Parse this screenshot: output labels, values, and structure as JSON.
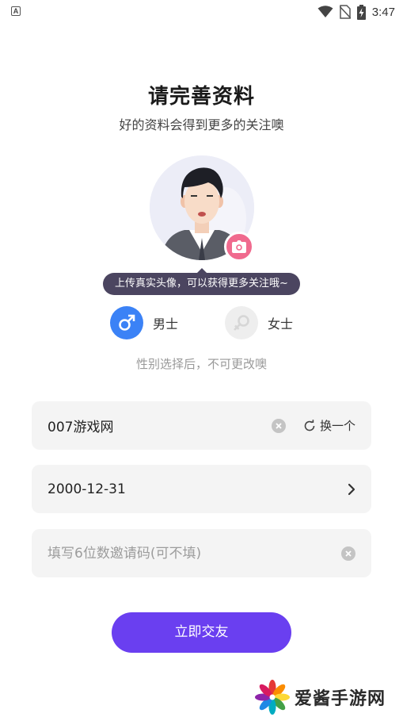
{
  "status_bar": {
    "notification_icon": "a-badge-icon",
    "notification_letter": "A",
    "icons": [
      "wifi-icon",
      "no-sim-icon",
      "battery-charging-icon"
    ],
    "time": "3:47"
  },
  "header": {
    "title": "请完善资料",
    "subtitle": "好的资料会得到更多的关注噢"
  },
  "avatar": {
    "image": "default-male-avatar",
    "upload_icon": "camera-icon",
    "tooltip": "上传真实头像，可以获得更多关注哦~"
  },
  "gender": {
    "options": [
      {
        "label": "男士",
        "icon": "male-icon",
        "selected": true
      },
      {
        "label": "女士",
        "icon": "female-icon",
        "selected": false
      }
    ],
    "note": "性别选择后，不可更改噢"
  },
  "form": {
    "nickname": {
      "value": "007游戏网",
      "clear_icon": "clear-icon",
      "swap_icon": "refresh-icon",
      "swap_label": "换一个"
    },
    "birthday": {
      "value": "2000-12-31",
      "arrow_icon": "chevron-right-icon"
    },
    "invite_code": {
      "value": "",
      "placeholder": "填写6位数邀请码(可不填)",
      "clear_icon": "clear-icon"
    }
  },
  "submit_label": "立即交友",
  "watermark": {
    "logo": "pinwheel-logo",
    "text": "爱酱手游网"
  },
  "colors": {
    "accent": "#6a3ff0",
    "male": "#3b82f6",
    "camera": "#f06a8e",
    "tooltip_bg": "#4b4560",
    "field_bg": "#f4f4f4"
  }
}
